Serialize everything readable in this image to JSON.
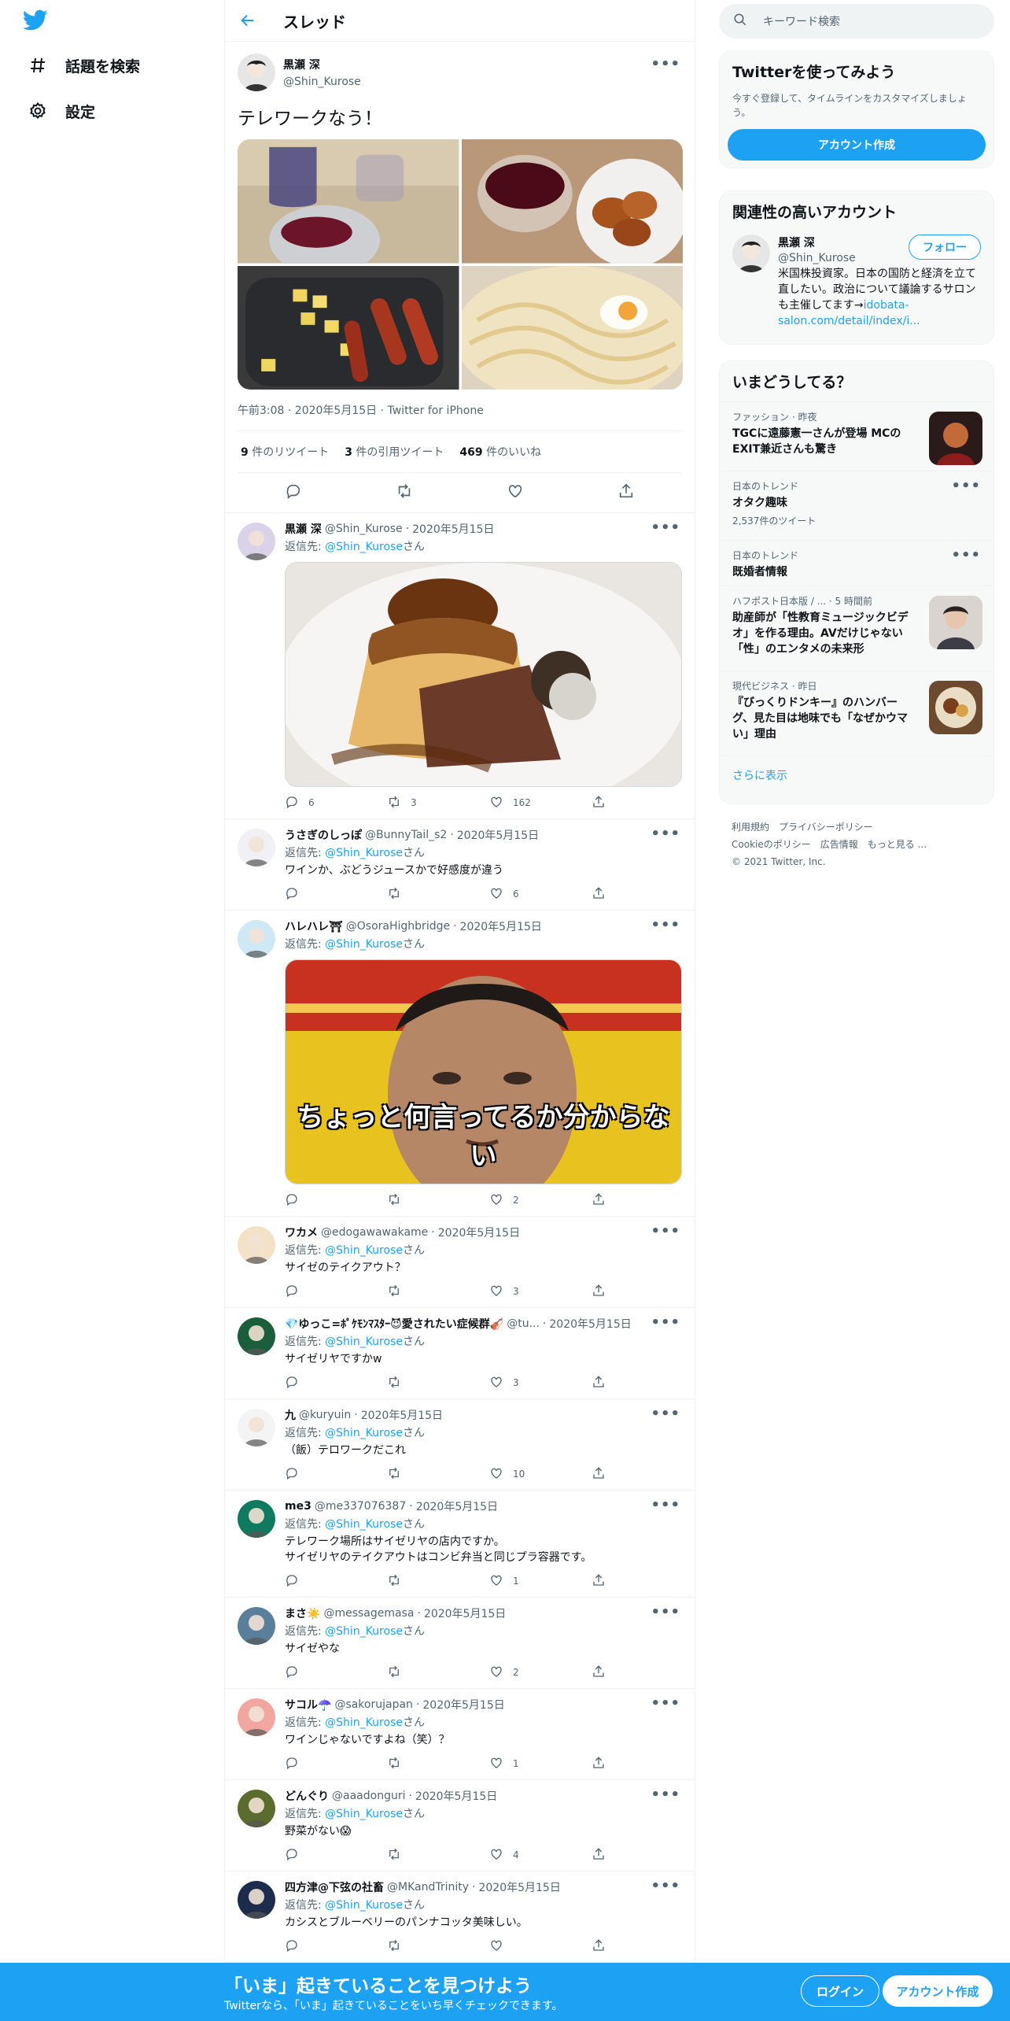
{
  "colors": {
    "accent": "#1da1f2",
    "text": "#0f1419",
    "muted": "#536471",
    "border": "#eff3f4"
  },
  "nav": {
    "logo_icon": "twitter-bird-icon",
    "items": [
      {
        "label": "話題を検索",
        "icon": "hashtag-icon"
      },
      {
        "label": "設定",
        "icon": "gear-icon"
      }
    ]
  },
  "header": {
    "title": "スレッド",
    "back_icon": "arrow-left-icon"
  },
  "focal": {
    "name": "黒瀬 深",
    "handle": "@Shin_Kurose",
    "text": "テレワークなう！",
    "photos": [
      "ワインとグラス",
      "ワインとから揚げ",
      "ソーセージとチーズ",
      "パスタと目玉焼き"
    ],
    "meta": "午前3:08 · 2020年5月15日 · Twitter for iPhone",
    "stats": {
      "retweets_num": "9",
      "retweets_label": " 件のリツイート",
      "quotes_num": "3",
      "quotes_label": " 件の引用ツイート",
      "likes_num": "469",
      "likes_label": " 件のいいね"
    }
  },
  "replies": [
    {
      "name": "黒瀬 深",
      "handle": "@Shin_Kurose",
      "date": "2020年5月15日",
      "replyto_prefix": "返信先: ",
      "replyto_user": "@Shin_Kurose",
      "replyto_suffix": "さん",
      "text": "",
      "media": "pudding",
      "replies": "6",
      "retweets": "3",
      "likes": "162"
    },
    {
      "name": "うさぎのしっぽ",
      "handle": "@BunnyTail_s2",
      "date": "2020年5月15日",
      "replyto_prefix": "返信先: ",
      "replyto_user": "@Shin_Kurose",
      "replyto_suffix": "さん",
      "text": "ワインか、ぶどうジュースかで好感度が違う",
      "replies": "",
      "retweets": "",
      "likes": "6"
    },
    {
      "name": "ハレハレ⛩",
      "handle": "@OsoraHighbridge",
      "date": "2020年5月15日",
      "replyto_prefix": "返信先: ",
      "replyto_user": "@Shin_Kurose",
      "replyto_suffix": "さん",
      "text": "",
      "media": "meme",
      "media_caption": "ちょっと何言ってるか分からない",
      "replies": "",
      "retweets": "",
      "likes": "2"
    },
    {
      "name": "ワカメ",
      "handle": "@edogawawakame",
      "date": "2020年5月15日",
      "replyto_prefix": "返信先: ",
      "replyto_user": "@Shin_Kurose",
      "replyto_suffix": "さん",
      "text": "サイゼのテイクアウト？",
      "replies": "",
      "retweets": "",
      "likes": "3"
    },
    {
      "name": "💎ゆっこ=ﾎﾟｹﾓﾝﾏｽﾀｰ😈愛されたい症候群🎻",
      "handle": "@tu...",
      "date": "2020年5月15日",
      "replyto_prefix": "返信先: ",
      "replyto_user": "@Shin_Kurose",
      "replyto_suffix": "さん",
      "text": "サイゼリヤですかw",
      "replies": "",
      "retweets": "",
      "likes": "3"
    },
    {
      "name": "九",
      "handle": "@kuryuin",
      "date": "2020年5月15日",
      "replyto_prefix": "返信先: ",
      "replyto_user": "@Shin_Kurose",
      "replyto_suffix": "さん",
      "text": "（飯）テロワークだこれ",
      "replies": "",
      "retweets": "",
      "likes": "10"
    },
    {
      "name": "me3",
      "handle": "@me337076387",
      "date": "2020年5月15日",
      "replyto_prefix": "返信先: ",
      "replyto_user": "@Shin_Kurose",
      "replyto_suffix": "さん",
      "text": "テレワーク場所はサイゼリヤの店内ですか。\nサイゼリヤのテイクアウトはコンビ弁当と同じプラ容器です。",
      "replies": "",
      "retweets": "",
      "likes": "1"
    },
    {
      "name": "まさ☀️",
      "handle": "@messagemasa",
      "date": "2020年5月15日",
      "replyto_prefix": "返信先: ",
      "replyto_user": "@Shin_Kurose",
      "replyto_suffix": "さん",
      "text": "サイゼやな",
      "replies": "",
      "retweets": "",
      "likes": "2"
    },
    {
      "name": "サコル☂️",
      "handle": "@sakorujapan",
      "date": "2020年5月15日",
      "replyto_prefix": "返信先: ",
      "replyto_user": "@Shin_Kurose",
      "replyto_suffix": "さん",
      "text": "ワインじゃないですよね（笑）？",
      "replies": "",
      "retweets": "",
      "likes": "1"
    },
    {
      "name": "どんぐり",
      "handle": "@aaadonguri",
      "date": "2020年5月15日",
      "replyto_prefix": "返信先: ",
      "replyto_user": "@Shin_Kurose",
      "replyto_suffix": "さん",
      "text": "野菜がない😱",
      "replies": "",
      "retweets": "",
      "likes": "4"
    },
    {
      "name": "四方津@下弦の社畜",
      "handle": "@MKandTrinity",
      "date": "2020年5月15日",
      "replyto_prefix": "返信先: ",
      "replyto_user": "@Shin_Kurose",
      "replyto_suffix": "さん",
      "text": "カシスとブルーベリーのパンナコッタ美味しい。",
      "replies": "",
      "retweets": "",
      "likes": ""
    }
  ],
  "sidebar": {
    "search_placeholder": "キーワード検索",
    "signup": {
      "title": "Twitterを使ってみよう",
      "subtitle": "今すぐ登録して、タイムラインをカスタマイズしましょう。",
      "button": "アカウント作成"
    },
    "related": {
      "title": "関連性の高いアカウント",
      "name": "黒瀬 深",
      "handle": "@Shin_Kurose",
      "follow": "フォロー",
      "bio": "米国株投資家。日本の国防と経済を立て直したい。政治について議論するサロンも主催してます→",
      "bio_link": "idobata-salon.com/detail/index/i..."
    },
    "trends": {
      "title": "いまどうしてる？",
      "items": [
        {
          "context": "ファッション · 昨夜",
          "title": "TGCに遠藤憲一さんが登場 MCのEXIT兼近さんも驚き",
          "count": ""
        },
        {
          "context": "日本のトレンド",
          "title": "オタク趣味",
          "count": "2,537件のツイート"
        },
        {
          "context": "日本のトレンド",
          "title": "既婚者情報",
          "count": ""
        },
        {
          "context": "ハフポスト日本版 / ... · 5 時間前",
          "title": "助産師が「性教育ミュージックビデオ」を作る理由。AVだけじゃない「性」のエンタメの未来形",
          "count": ""
        },
        {
          "context": "現代ビジネス · 昨日",
          "title": "『びっくりドンキー』のハンバーグ、見た目は地味でも「なぜかウマい」理由",
          "count": ""
        }
      ],
      "show_more": "さらに表示"
    },
    "footer": {
      "terms": "利用規約",
      "privacy": "プライバシーポリシー",
      "cookies": "Cookieのポリシー",
      "ads": "広告情報",
      "more": "もっと見る ...",
      "copyright": "© 2021 Twitter, Inc."
    }
  },
  "bottombar": {
    "title": "「いま」起きていることを見つけよう",
    "subtitle": "Twitterなら、「いま」起きていることをいち早くチェックできます。",
    "login": "ログイン",
    "signup": "アカウント作成"
  }
}
